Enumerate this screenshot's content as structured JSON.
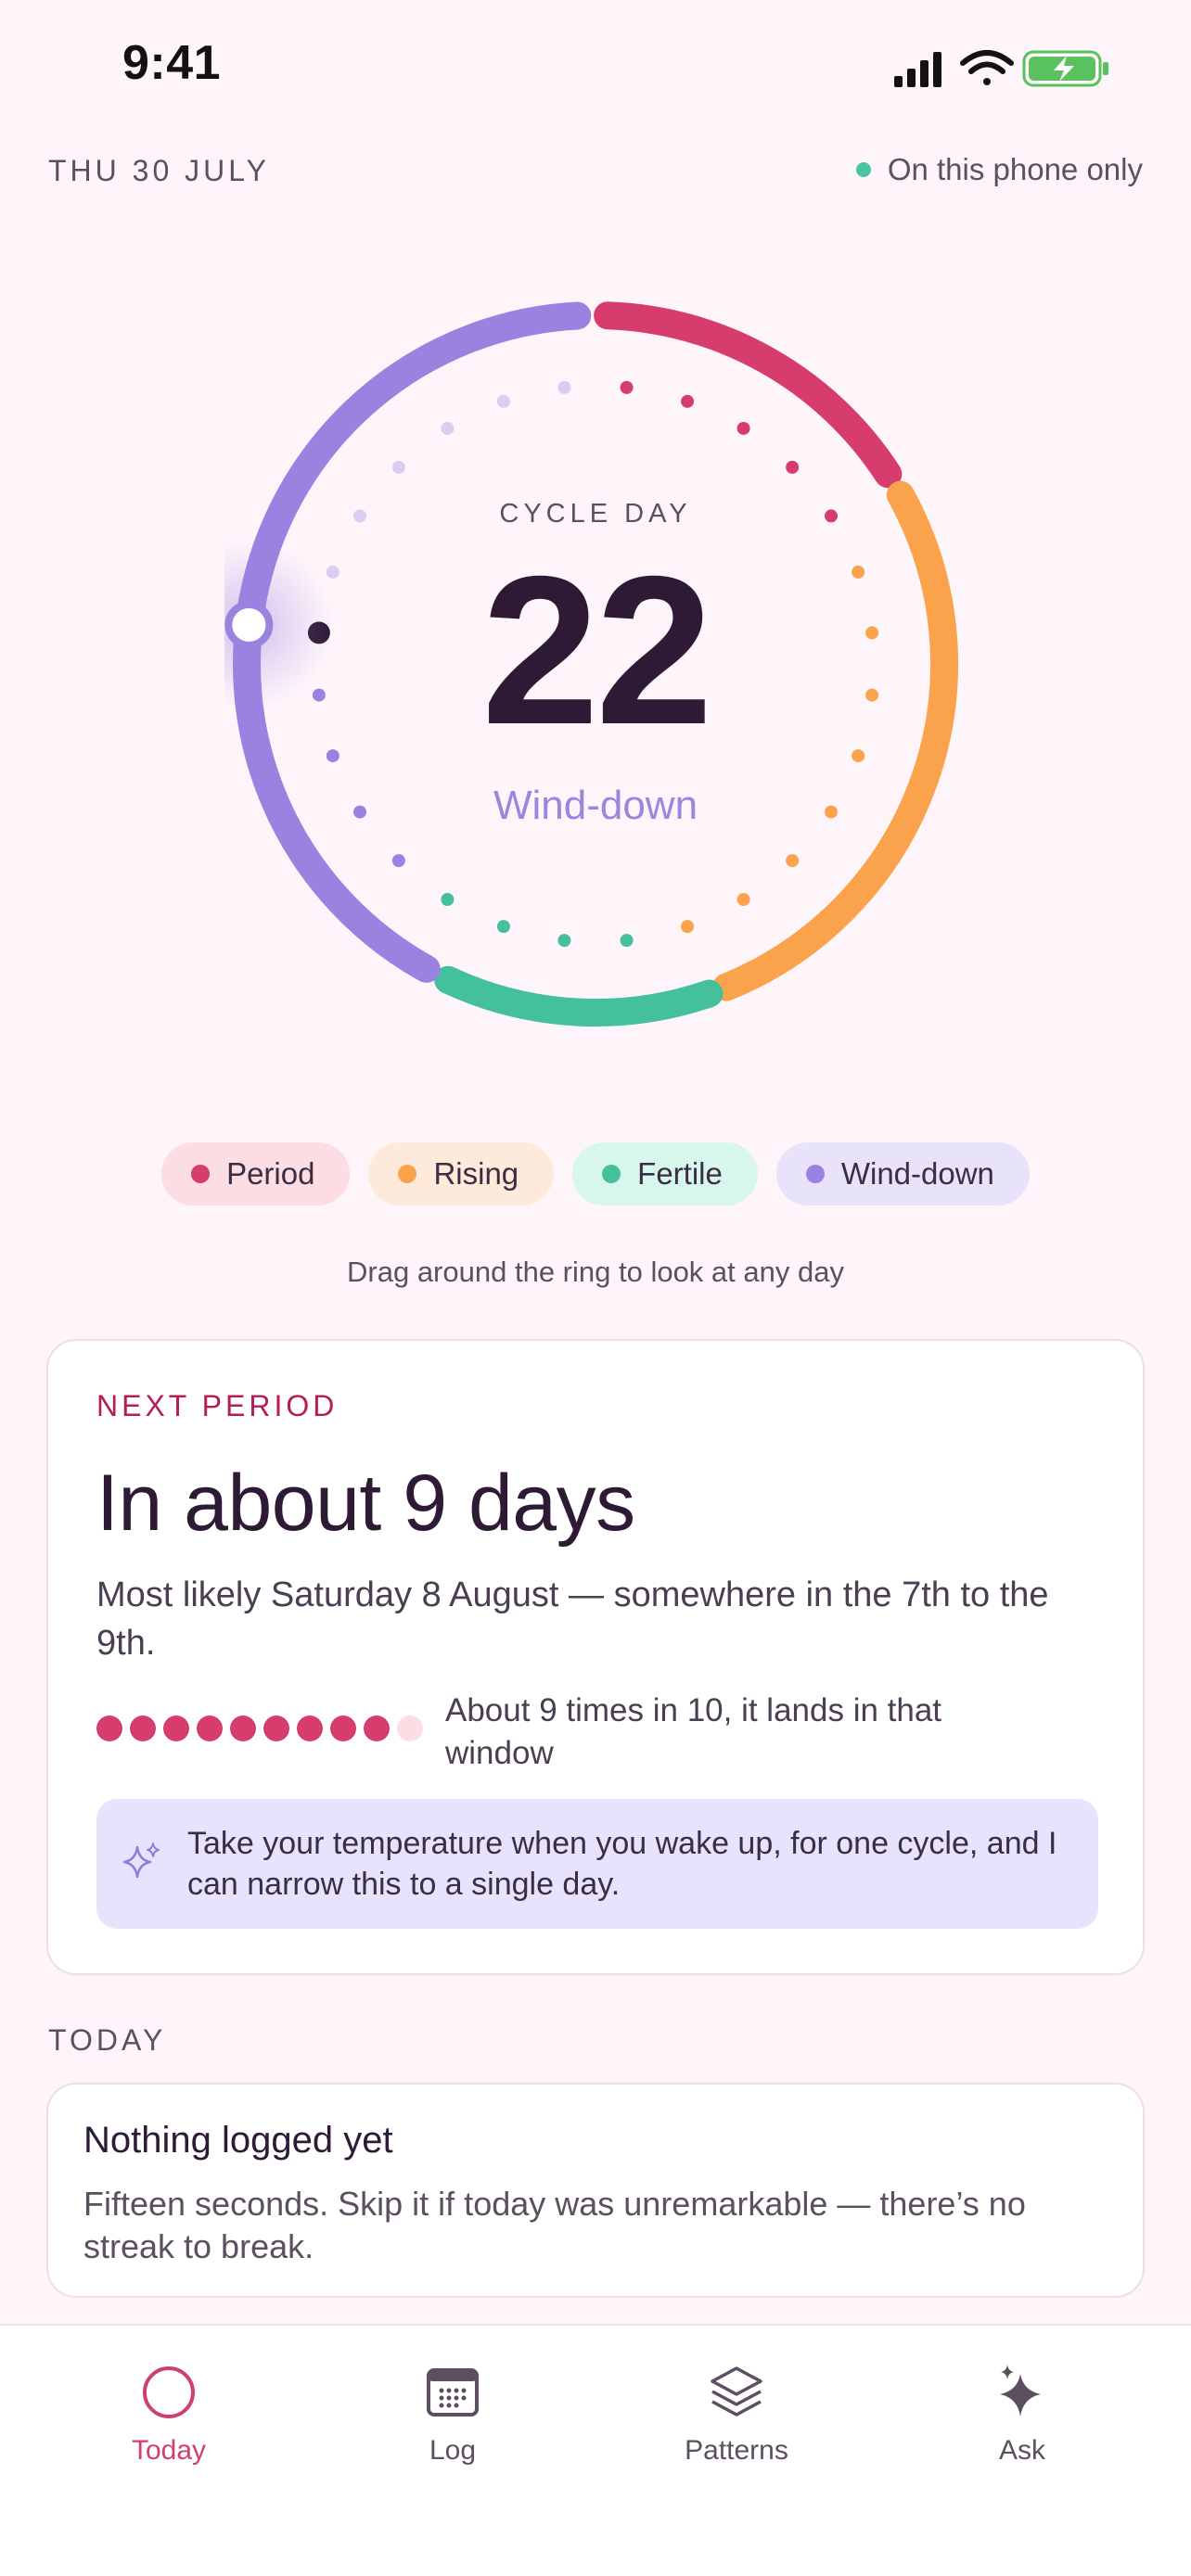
{
  "status_bar": {
    "time": "9:41",
    "icons": [
      "cellular-signal-icon",
      "wifi-icon",
      "battery-charging-icon"
    ]
  },
  "header": {
    "date": "THU 30 JULY",
    "privacy": "On this phone only"
  },
  "ring": {
    "label": "CYCLE DAY",
    "day": "22",
    "phase": "Wind-down",
    "cycle_length": 28
  },
  "legend": [
    {
      "label": "Period",
      "color": "#d63d6c",
      "bg": "#fcdde4"
    },
    {
      "label": "Rising",
      "color": "#fba24c",
      "bg": "#feeada"
    },
    {
      "label": "Fertile",
      "color": "#45c09c",
      "bg": "#d7f6ec"
    },
    {
      "label": "Wind-down",
      "color": "#9a83e0",
      "bg": "#e8e3fb"
    }
  ],
  "hint": "Drag around the ring to look at any day",
  "next_period": {
    "eyebrow": "NEXT PERIOD",
    "heading": "In about 9 days",
    "description": "Most likely Saturday 8 August — somewhere in the 7th to the 9th.",
    "confidence_filled": 9,
    "confidence_total": 10,
    "confidence_text": "About 9 times in 10, it lands in that window",
    "tip": "Take your temperature when you wake up, for one cycle, and I can narrow this to a single day."
  },
  "today": {
    "section": "TODAY",
    "title": "Nothing logged yet",
    "subtitle": "Fifteen seconds. Skip it if today was unremarkable — there’s no streak to break."
  },
  "tabs": [
    {
      "label": "Today",
      "icon": "circle-icon",
      "active": true
    },
    {
      "label": "Log",
      "icon": "calendar-icon",
      "active": false
    },
    {
      "label": "Patterns",
      "icon": "layers-icon",
      "active": false
    },
    {
      "label": "Ask",
      "icon": "sparkle-icon",
      "active": false
    }
  ],
  "colors": {
    "accent": "#cf3f6f",
    "background": "#fdf5fa"
  }
}
